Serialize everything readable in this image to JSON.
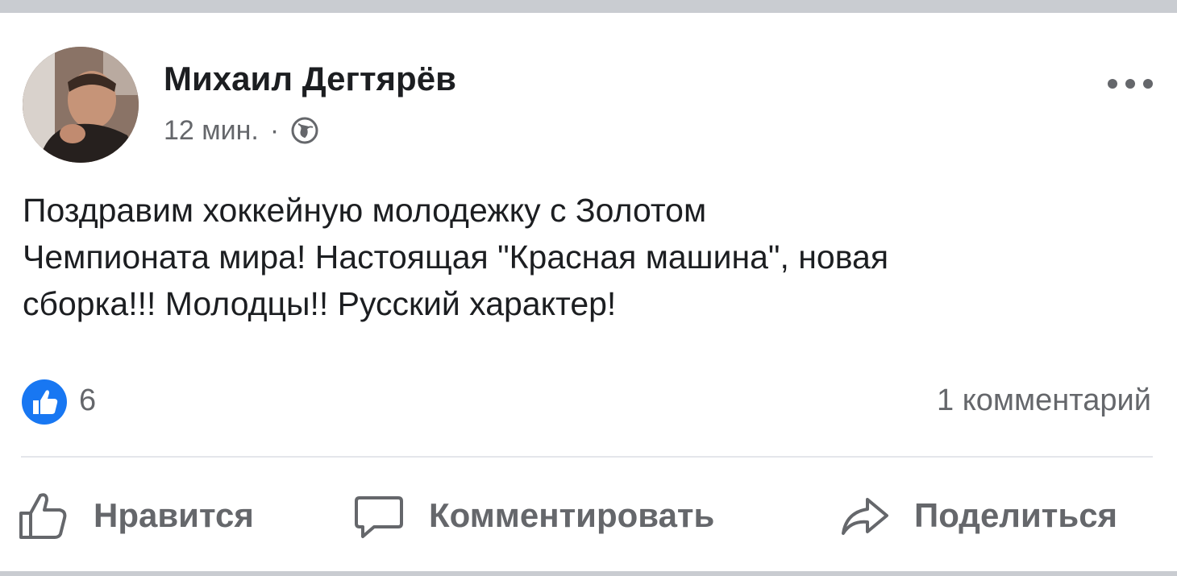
{
  "post": {
    "author": "Михаил Дегтярёв",
    "time": "12 мин.",
    "separator": "·",
    "privacy_icon": "globe-icon",
    "more_icon": "more-dots-icon",
    "text": "Поздравим хоккейную молодежку с Золотом\nЧемпионата мира! Настоящая \"Красная машина\", новая\nсборка!!! Молодцы!! Русский характер!"
  },
  "stats": {
    "reaction_icon": "like-reaction-icon",
    "likes": "6",
    "comments": "1 комментарий"
  },
  "actions": {
    "like": {
      "label": "Нравится",
      "icon": "thumbs-up-icon"
    },
    "comment": {
      "label": "Комментировать",
      "icon": "speech-bubble-icon"
    },
    "share": {
      "label": "Поделиться",
      "icon": "share-arrow-icon"
    }
  },
  "colors": {
    "text": "#1c1e21",
    "secondary": "#65676b",
    "like_blue": "#1877f2",
    "separator": "#c9ccd1"
  }
}
